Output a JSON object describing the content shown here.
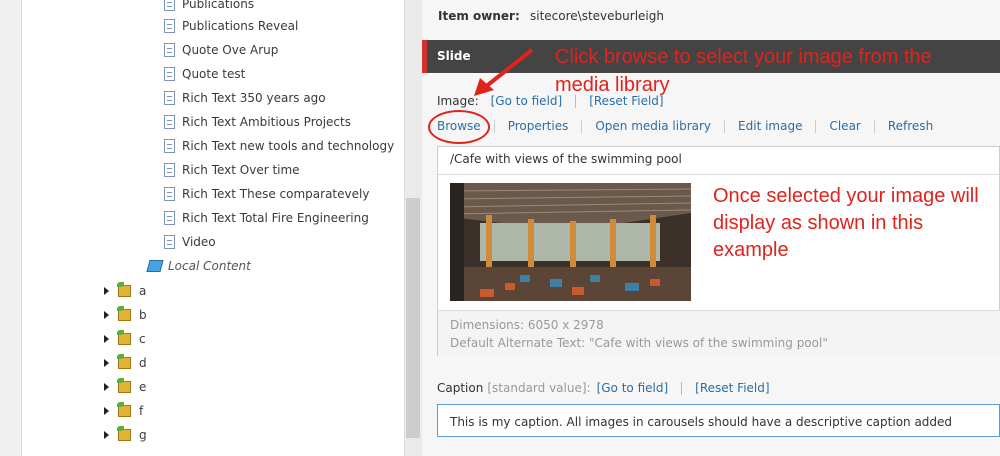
{
  "tree": {
    "items": [
      {
        "label": "Publications",
        "type": "doc"
      },
      {
        "label": "Publications Reveal",
        "type": "doc"
      },
      {
        "label": "Quote Ove Arup",
        "type": "doc"
      },
      {
        "label": "Quote test",
        "type": "doc"
      },
      {
        "label": "Rich Text 350 years ago",
        "type": "doc"
      },
      {
        "label": "Rich Text Ambitious Projects",
        "type": "doc"
      },
      {
        "label": "Rich Text new tools and technology",
        "type": "doc"
      },
      {
        "label": "Rich Text Over time",
        "type": "doc"
      },
      {
        "label": "Rich Text These comparatevely",
        "type": "doc"
      },
      {
        "label": "Rich Text Total Fire Engineering",
        "type": "doc"
      },
      {
        "label": "Video",
        "type": "doc"
      }
    ],
    "local_content": "Local Content",
    "folders": [
      "a",
      "b",
      "c",
      "d",
      "e",
      "f",
      "g"
    ]
  },
  "item": {
    "owner_label": "Item owner:",
    "owner_value": "sitecore\\steveburleigh"
  },
  "section": {
    "title": "Slide",
    "accent_color": "#d0312d"
  },
  "image_field": {
    "label": "Image:",
    "go_to_field": "[Go to field]",
    "reset_field": "[Reset Field]",
    "toolbar": [
      "Browse",
      "Properties",
      "Open media library",
      "Edit image",
      "Clear",
      "Refresh"
    ],
    "path": "/Cafe with views of the swimming pool",
    "dimensions": "Dimensions: 6050 x 2978",
    "alt_text": "Default Alternate Text: \"Cafe with views of the swimming pool\""
  },
  "caption_field": {
    "label": "Caption",
    "standard_value": "[standard value]:",
    "go_to_field": "[Go to field]",
    "reset_field": "[Reset Field]",
    "value": "This is my caption. All images in carousels should have a descriptive caption added"
  },
  "annotations": {
    "browse_hint": "Click browse to select your image from the media library",
    "display_hint": "Once selected your image will display as shown in this example",
    "color": "#e0231c"
  }
}
